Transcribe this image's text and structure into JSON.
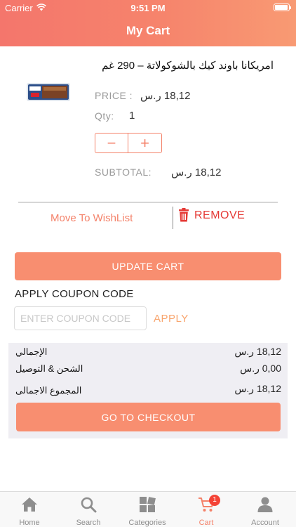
{
  "status_bar": {
    "carrier": "Carrier",
    "time": "9:51 PM"
  },
  "header": {
    "title": "My Cart"
  },
  "product": {
    "name": "امريكانا باوند كيك بالشوكولاتة – 290 غم",
    "price_label": "PRICE :",
    "price_value": "18,12 ر.س",
    "qty_label": "Qty:",
    "qty_value": "1",
    "subtotal_label": "SUBTOTAL:",
    "subtotal_value": "18,12 ر.س"
  },
  "stepper": {
    "minus": "−",
    "plus": "+"
  },
  "actions": {
    "wishlist": "Move To WishList",
    "remove": "REMOVE"
  },
  "update_cart": "UPDATE CART",
  "coupon": {
    "heading": "APPLY COUPON CODE",
    "placeholder": "ENTER COUPON CODE",
    "apply": "APPLY"
  },
  "summary": {
    "rows": [
      {
        "label": "الإجمالي",
        "value": "18,12 ر.س"
      },
      {
        "label": "الشحن & التوصيل",
        "value": "0,00 ر.س"
      },
      {
        "label": "المجموع الاجمالى",
        "value": "18,12 ر.س"
      }
    ],
    "checkout": "GO TO CHECKOUT"
  },
  "tabbar": {
    "items": [
      {
        "label": "Home",
        "icon": "home-icon"
      },
      {
        "label": "Search",
        "icon": "search-icon"
      },
      {
        "label": "Categories",
        "icon": "categories-icon"
      },
      {
        "label": "Cart",
        "icon": "cart-icon",
        "active": true,
        "badge": "1"
      },
      {
        "label": "Account",
        "icon": "account-icon"
      }
    ]
  },
  "colors": {
    "accent": "#f4826a",
    "danger": "#e53935",
    "tab_inactive": "#8e8e8e"
  }
}
